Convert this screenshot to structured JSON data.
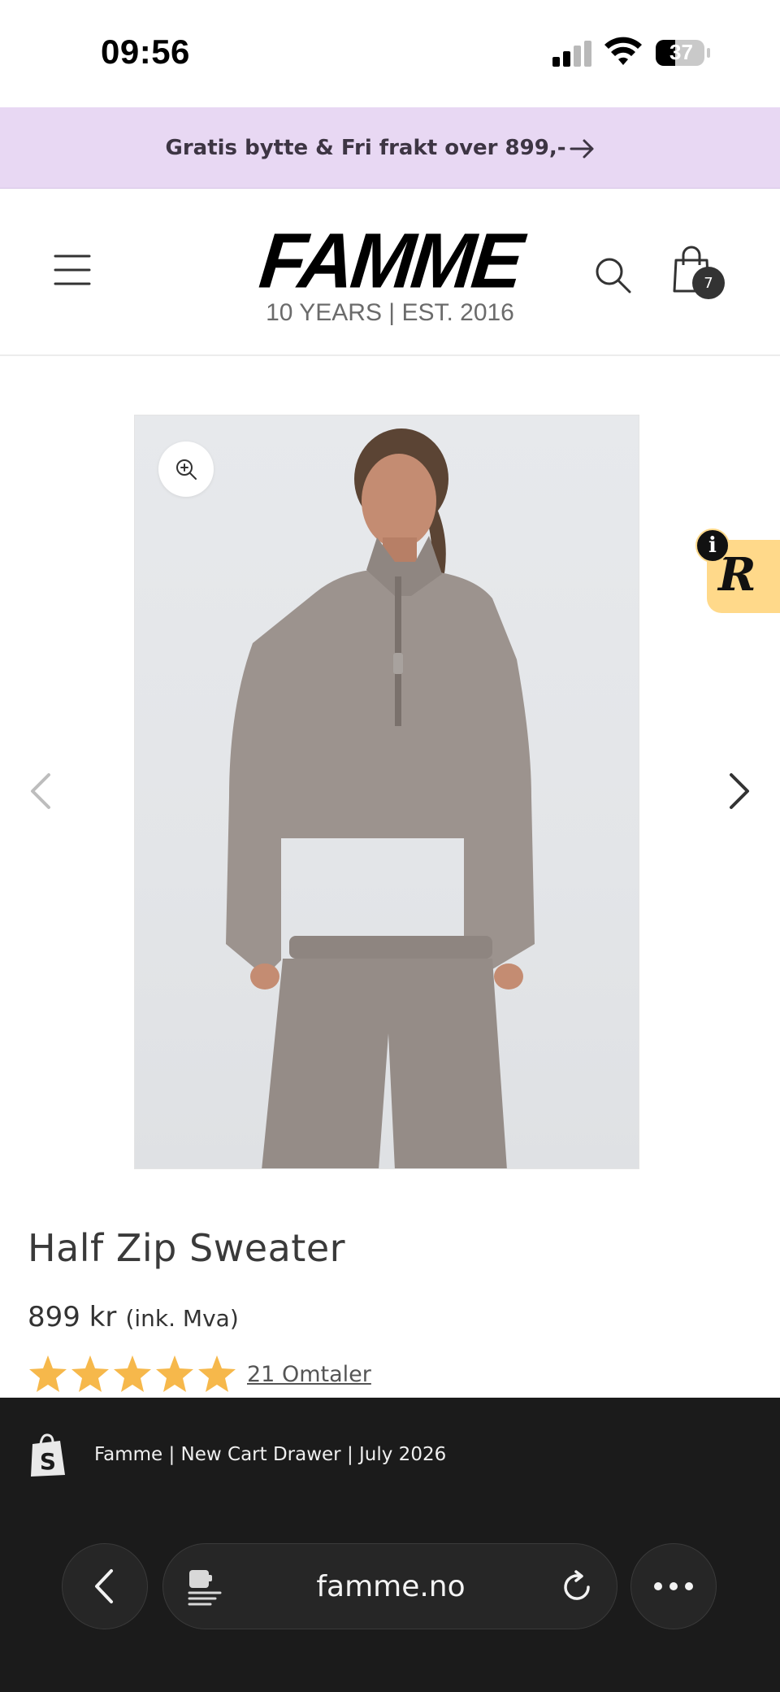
{
  "status_bar": {
    "time": "09:56",
    "battery_level": "37"
  },
  "announcement": {
    "text": "Gratis bytte & Fri frakt over 899,-"
  },
  "header": {
    "logo_text": "FAMME",
    "logo_subtitle": "10 YEARS |  EST. 2016",
    "cart_count": "7"
  },
  "rewards_widget": {
    "letter": "R",
    "info_label": "i"
  },
  "product": {
    "title": "Half Zip Sweater",
    "price": "899 kr",
    "price_note": "(ink. Mva)",
    "rating": 5,
    "rating_max": 5,
    "reviews_label": "21 Omtaler"
  },
  "browser": {
    "banner_text": "Famme | New Cart Drawer | July 2026",
    "url": "famme.no"
  },
  "colors": {
    "announce_bg": "#e8d8f3",
    "star": "#f6b84b",
    "bottom_bar": "#1b1b1b",
    "rewards_bg": "#ffd98a"
  }
}
